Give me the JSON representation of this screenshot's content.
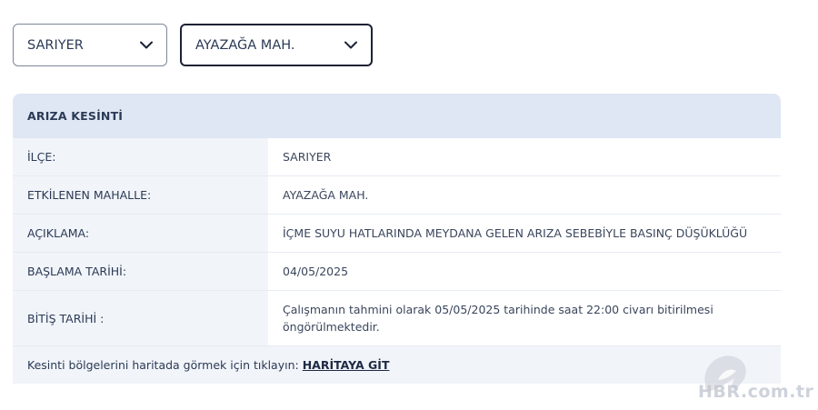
{
  "filters": {
    "district": "SARIYER",
    "neighborhood": "AYAZAĞA MAH."
  },
  "panel": {
    "title": "ARIZA KESİNTİ",
    "rows": [
      {
        "label": "İLÇE:",
        "value": "SARIYER"
      },
      {
        "label": "ETKİLENEN MAHALLE:",
        "value": "AYAZAĞA MAH."
      },
      {
        "label": "AÇIKLAMA:",
        "value": "İÇME SUYU HATLARINDA MEYDANA GELEN ARIZA SEBEBİYLE BASINÇ DÜŞÜKLÜĞÜ"
      },
      {
        "label": "BAŞLAMA TARİHİ:",
        "value": "04/05/2025"
      },
      {
        "label": "BİTİŞ TARİHİ :",
        "value": "Çalışmanın tahmini olarak 05/05/2025 tarihinde saat 22:00 civarı bitirilmesi öngörülmektedir."
      }
    ],
    "footer_text": "Kesinti bölgelerini haritada görmek için tıklayın:",
    "footer_link": "HARİTAYA GİT"
  },
  "watermark": {
    "text": "HBR.com.tr"
  },
  "colors": {
    "header_bg": "#dfe7f5",
    "label_bg": "#f1f4f9",
    "text": "#2b3a55"
  }
}
